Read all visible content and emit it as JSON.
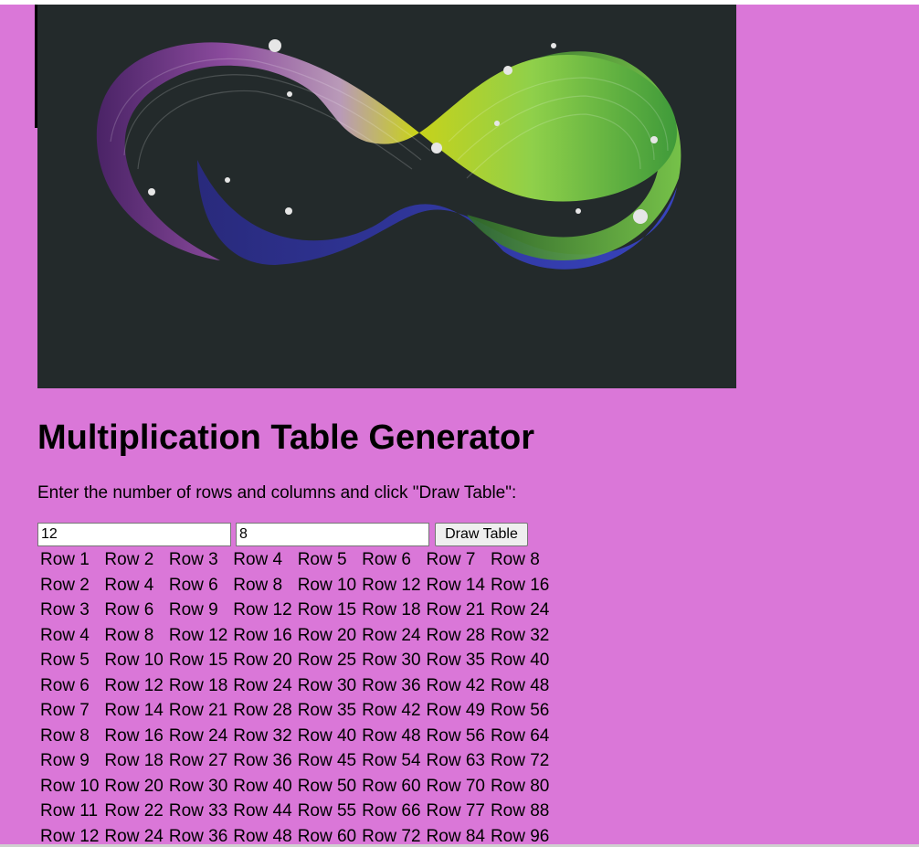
{
  "colors": {
    "page_background": "#da77d8",
    "hero_background": "#232a2b",
    "text": "#000000"
  },
  "hero_image": {
    "alt": "Colorful infinity loop ribbon",
    "gradient_colors": [
      "#5a2a77",
      "#a060b0",
      "#d4df10",
      "#6fc24a",
      "#3a44d0"
    ]
  },
  "header": {
    "title": "Multiplication Table Generator"
  },
  "instructions": "Enter the number of rows and columns and click \"Draw Table\":",
  "form": {
    "rows_value": "12",
    "columns_value": "8",
    "draw_button_label": "Draw Table"
  },
  "table": {
    "rows": [
      [
        "Row 1",
        "Row 2",
        "Row 3",
        "Row 4",
        "Row 5",
        "Row 6",
        "Row 7",
        "Row 8"
      ],
      [
        "Row 2",
        "Row 4",
        "Row 6",
        "Row 8",
        "Row 10",
        "Row 12",
        "Row 14",
        "Row 16"
      ],
      [
        "Row 3",
        "Row 6",
        "Row 9",
        "Row 12",
        "Row 15",
        "Row 18",
        "Row 21",
        "Row 24"
      ],
      [
        "Row 4",
        "Row 8",
        "Row 12",
        "Row 16",
        "Row 20",
        "Row 24",
        "Row 28",
        "Row 32"
      ],
      [
        "Row 5",
        "Row 10",
        "Row 15",
        "Row 20",
        "Row 25",
        "Row 30",
        "Row 35",
        "Row 40"
      ],
      [
        "Row 6",
        "Row 12",
        "Row 18",
        "Row 24",
        "Row 30",
        "Row 36",
        "Row 42",
        "Row 48"
      ],
      [
        "Row 7",
        "Row 14",
        "Row 21",
        "Row 28",
        "Row 35",
        "Row 42",
        "Row 49",
        "Row 56"
      ],
      [
        "Row 8",
        "Row 16",
        "Row 24",
        "Row 32",
        "Row 40",
        "Row 48",
        "Row 56",
        "Row 64"
      ],
      [
        "Row 9",
        "Row 18",
        "Row 27",
        "Row 36",
        "Row 45",
        "Row 54",
        "Row 63",
        "Row 72"
      ],
      [
        "Row 10",
        "Row 20",
        "Row 30",
        "Row 40",
        "Row 50",
        "Row 60",
        "Row 70",
        "Row 80"
      ],
      [
        "Row 11",
        "Row 22",
        "Row 33",
        "Row 44",
        "Row 55",
        "Row 66",
        "Row 77",
        "Row 88"
      ],
      [
        "Row 12",
        "Row 24",
        "Row 36",
        "Row 48",
        "Row 60",
        "Row 72",
        "Row 84",
        "Row 96"
      ]
    ]
  }
}
